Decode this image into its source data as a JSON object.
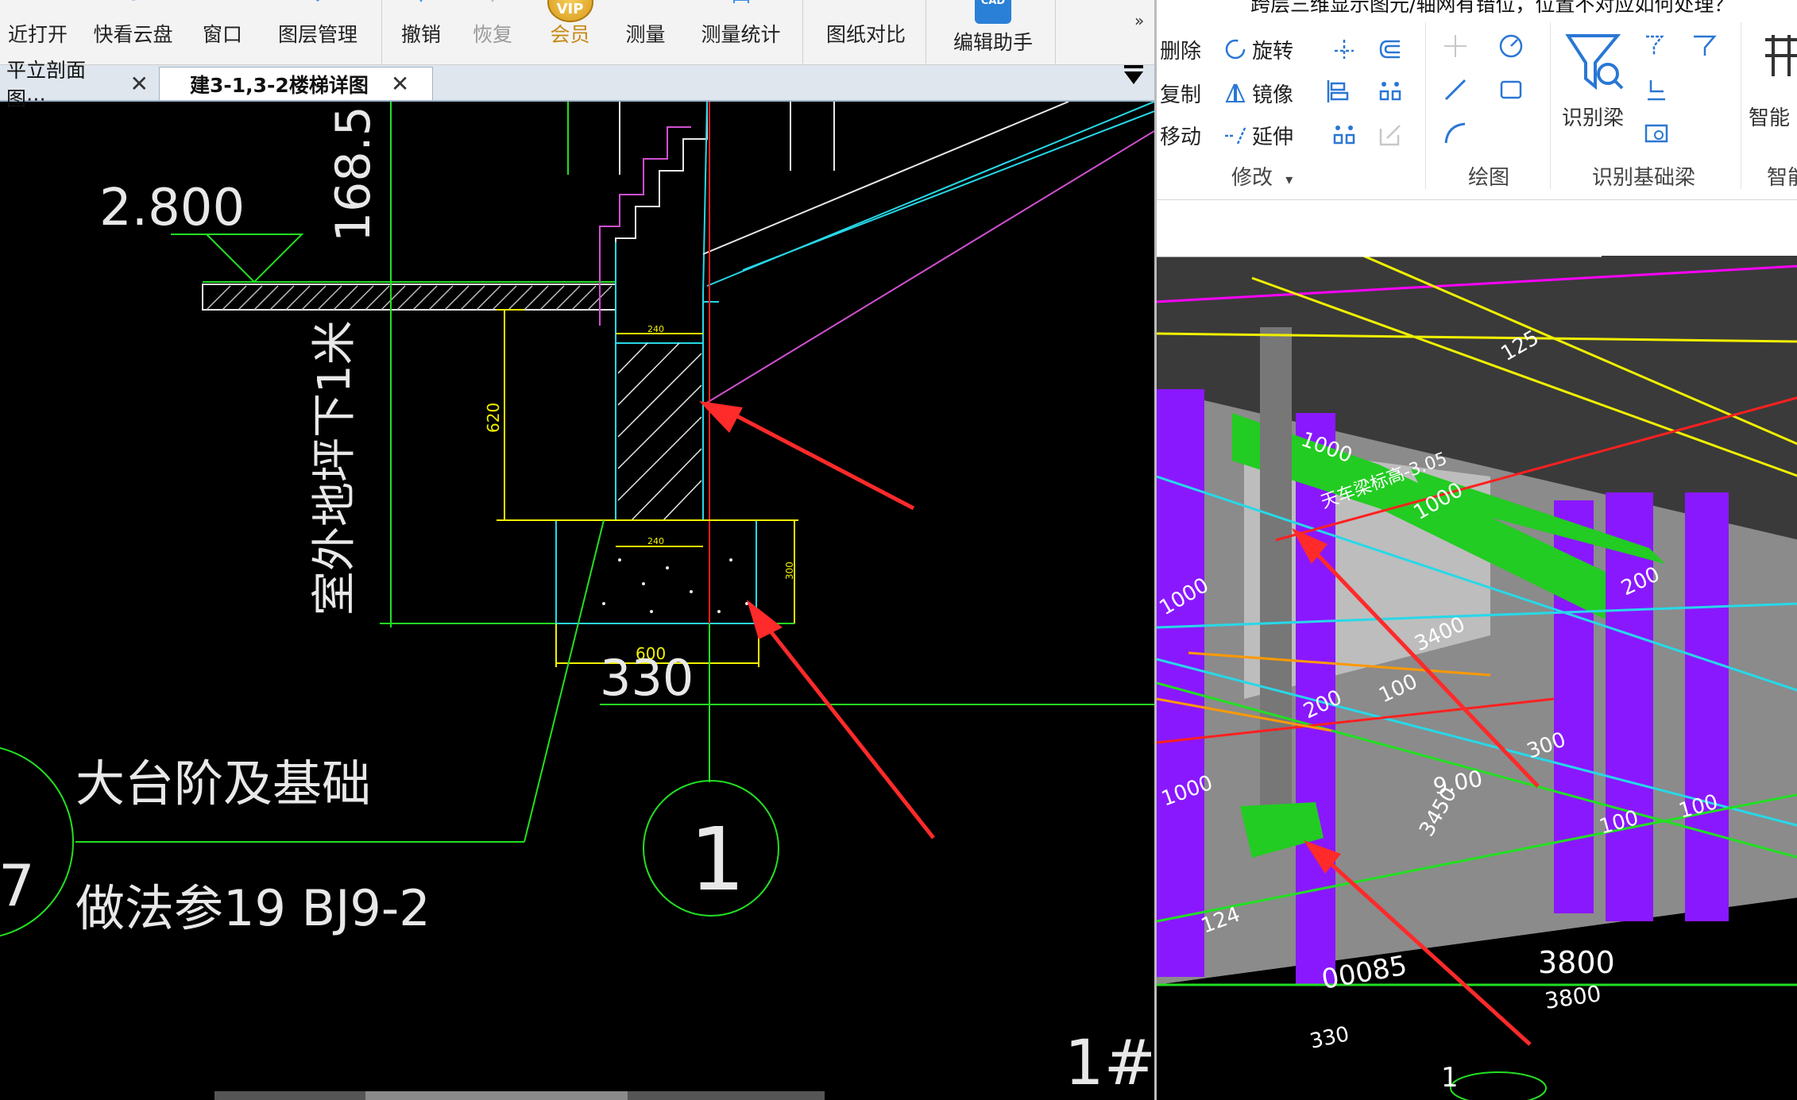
{
  "question_title": "跨层三维显示图元/轴网有错位，位置不对应如何处理？",
  "left_toolbar": {
    "recent_open": "近打开",
    "quick_cloud": "快看云盘",
    "window": "窗口",
    "layer_mgmt": "图层管理",
    "undo": "撤销",
    "redo": "恢复",
    "vip_badge": "VIP",
    "vip_label": "会员",
    "measure": "测量",
    "measure_stats": "测量统计",
    "compare": "图纸对比",
    "cad_badge": "CAD",
    "edit_helper": "编辑助手",
    "more": "»"
  },
  "doc_tabs": [
    {
      "label": "平立剖面图⋯",
      "close": "✕"
    },
    {
      "label": "建3-1,3-2楼梯详图",
      "close": "✕"
    }
  ],
  "cad": {
    "elevation": "2.800",
    "dim_168": "168.5",
    "dim_240_top": "240",
    "dim_620": "620",
    "dim_240_mid": "240",
    "dim_300": "300",
    "dim_600": "600",
    "dim_330": "330",
    "outdoor_note": "室外地坪下1米",
    "title_big": "大台阶及基础",
    "title_method": "做法参19 BJ9-2",
    "detail_no": "1",
    "left_circle_no": "7",
    "sheet_mark": "1#"
  },
  "ribbon": {
    "delete": "删除",
    "rotate": "旋转",
    "copy": "复制",
    "mirror": "镜像",
    "move": "移动",
    "extend": "延伸",
    "group_modify": "修改",
    "group_modify_caret": "▾",
    "group_draw": "绘图",
    "identify_beam": "识别梁",
    "group_identify_foundation_beam": "识别基础梁",
    "smart_label": "智能",
    "smart_group": "智能"
  },
  "view3d": {
    "dims": [
      "3800",
      "3800",
      "330",
      "1000",
      "1000",
      "1000",
      "3400",
      "200",
      "100",
      "100",
      "100",
      "200",
      "9.00",
      "3450",
      "124",
      "300",
      "125",
      "1000"
    ],
    "label_0085": "00085",
    "axis_no": "1",
    "floor_note": "天车梁标高-3.05"
  },
  "colors": {
    "arrow": "#ff2a2a",
    "cad_cyan": "#27d8e8",
    "cad_green": "#22e022",
    "cad_yellow": "#f0f000",
    "cad_magenta": "#d050d0",
    "cad_white": "#e8e8e8",
    "view_purple": "#8a18ff",
    "view_green": "#22cc22",
    "view_grey": "#9a9a9a"
  }
}
